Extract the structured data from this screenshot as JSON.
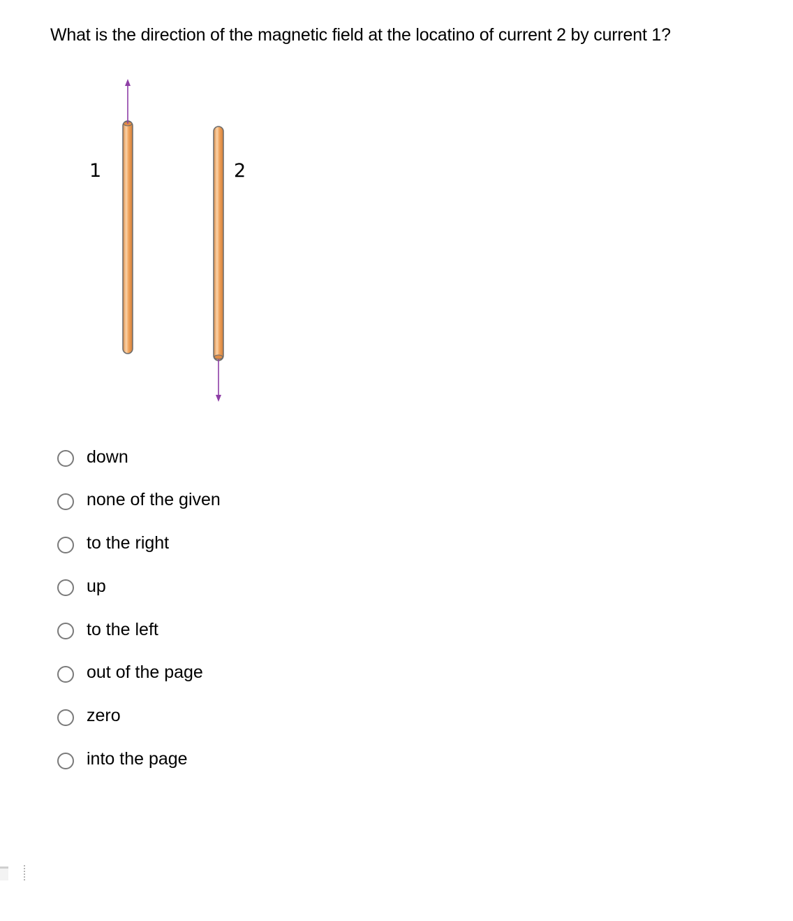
{
  "question": {
    "text": "What is the direction of the magnetic field at the locatino of current 2 by current 1?"
  },
  "figure": {
    "wire_1": {
      "label": "1",
      "current_direction": "up"
    },
    "wire_2": {
      "label": "2",
      "current_direction": "down"
    },
    "colors": {
      "wire": "#f0a25a",
      "wire_outline": "#6b6b6b",
      "arrow": "#8e3fa6"
    }
  },
  "options": [
    {
      "label": "down",
      "selected": false
    },
    {
      "label": "none of the given",
      "selected": false
    },
    {
      "label": "to the right",
      "selected": false
    },
    {
      "label": "up",
      "selected": false
    },
    {
      "label": "to the left",
      "selected": false
    },
    {
      "label": "out of the page",
      "selected": false
    },
    {
      "label": "zero",
      "selected": false
    },
    {
      "label": "into the page",
      "selected": false
    }
  ]
}
